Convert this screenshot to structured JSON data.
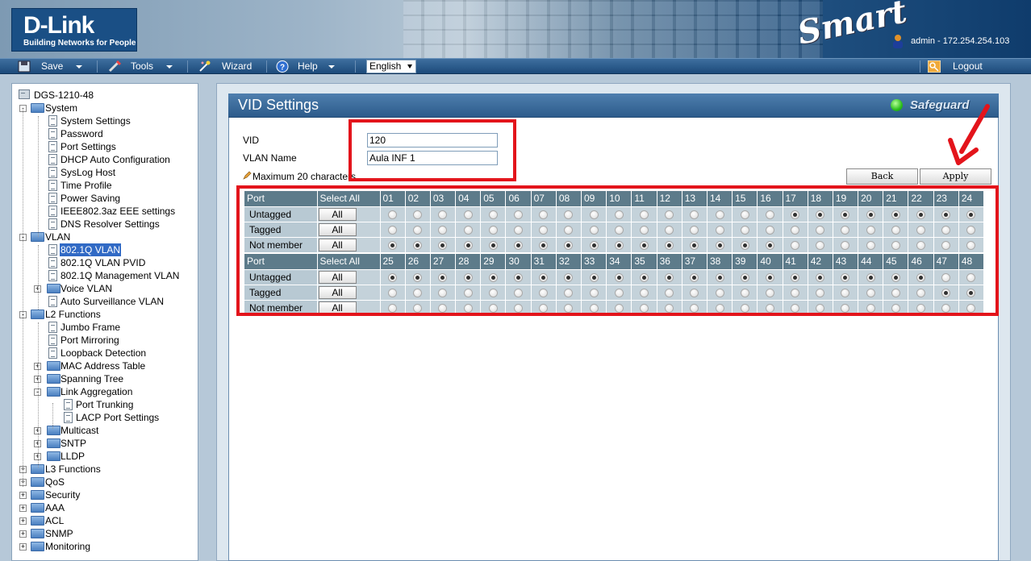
{
  "header": {
    "brand": "D-Link",
    "tagline": "Building Networks for People",
    "product_logo": "Smart",
    "user_info": "admin - 172.254.254.103"
  },
  "menubar": {
    "save": "Save",
    "tools": "Tools",
    "wizard": "Wizard",
    "help": "Help",
    "language": "English",
    "logout": "Logout"
  },
  "sidebar": {
    "device": "DGS-1210-48",
    "items": [
      "System",
      "System Settings",
      "Password",
      "Port Settings",
      "DHCP Auto Configuration",
      "SysLog Host",
      "Time Profile",
      "Power Saving",
      "IEEE802.3az EEE settings",
      "DNS Resolver Settings",
      "VLAN",
      "802.1Q VLAN",
      "802.1Q VLAN PVID",
      "802.1Q Management VLAN",
      "Voice VLAN",
      "Auto Surveillance VLAN",
      "L2 Functions",
      "Jumbo Frame",
      "Port Mirroring",
      "Loopback Detection",
      "MAC Address Table",
      "Spanning Tree",
      "Link Aggregation",
      "Port Trunking",
      "LACP Port Settings",
      "Multicast",
      "SNTP",
      "LLDP",
      "L3 Functions",
      "QoS",
      "Security",
      "AAA",
      "ACL",
      "SNMP",
      "Monitoring"
    ]
  },
  "panel": {
    "title": "VID Settings",
    "safeguard": "Safeguard",
    "vid_label": "VID",
    "vid_value": "120",
    "vlan_name_label": "VLAN Name",
    "vlan_name_value": "Aula INF 1",
    "note": "Maximum 20 characters",
    "back_button": "Back",
    "apply_button": "Apply"
  },
  "port_table": {
    "port_label": "Port",
    "select_all": "Select All",
    "all_button": "All",
    "rows": [
      "Untagged",
      "Tagged",
      "Not member"
    ],
    "group1_ports": [
      "01",
      "02",
      "03",
      "04",
      "05",
      "06",
      "07",
      "08",
      "09",
      "10",
      "11",
      "12",
      "13",
      "14",
      "15",
      "16",
      "17",
      "18",
      "19",
      "20",
      "21",
      "22",
      "23",
      "24"
    ],
    "group2_ports": [
      "25",
      "26",
      "27",
      "28",
      "29",
      "30",
      "31",
      "32",
      "33",
      "34",
      "35",
      "36",
      "37",
      "38",
      "39",
      "40",
      "41",
      "42",
      "43",
      "44",
      "45",
      "46",
      "47",
      "48"
    ],
    "group1_membership": [
      "N",
      "N",
      "N",
      "N",
      "N",
      "N",
      "N",
      "N",
      "N",
      "N",
      "N",
      "N",
      "N",
      "N",
      "N",
      "N",
      "U",
      "U",
      "U",
      "U",
      "U",
      "U",
      "U",
      "U"
    ],
    "group2_membership": [
      "U",
      "U",
      "U",
      "U",
      "U",
      "U",
      "U",
      "U",
      "U",
      "U",
      "U",
      "U",
      "U",
      "U",
      "U",
      "U",
      "U",
      "U",
      "U",
      "U",
      "U",
      "U",
      "T",
      "T"
    ]
  }
}
